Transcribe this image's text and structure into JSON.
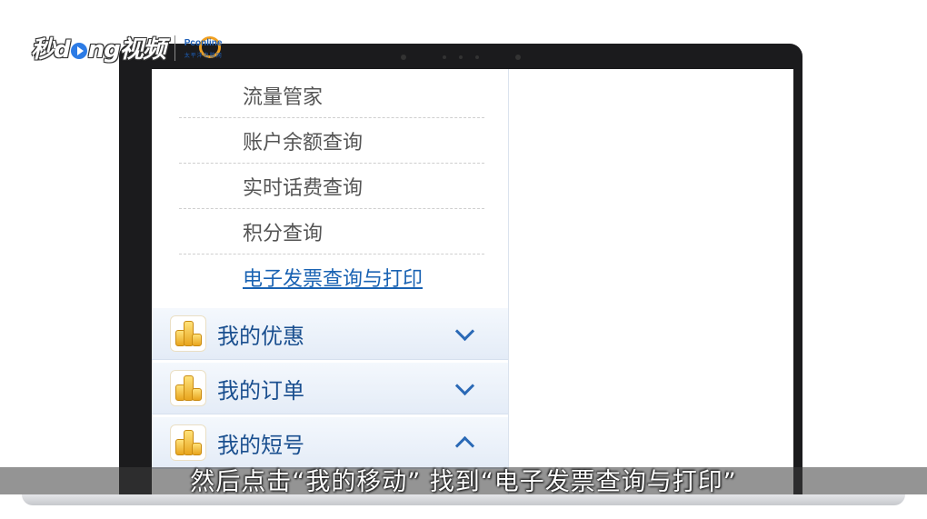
{
  "watermark": {
    "brand_pre": "秒d",
    "brand_post": "ng视频",
    "partner": "Pconline",
    "partner_cn": "太平洋电脑网"
  },
  "menu": {
    "sub_items": [
      {
        "label": "流量管家"
      },
      {
        "label": "账户余额查询"
      },
      {
        "label": "实时话费查询"
      },
      {
        "label": "积分查询"
      },
      {
        "label": "电子发票查询与打印"
      }
    ],
    "categories": [
      {
        "label": "我的优惠",
        "state": "collapsed"
      },
      {
        "label": "我的订单",
        "state": "collapsed"
      },
      {
        "label": "我的短号",
        "state": "expanded"
      }
    ]
  },
  "subtitle": "然后点击“我的移动” 找到“电子发票查询与打印”",
  "colors": {
    "link": "#1a63b3",
    "category_text": "#1a4f8f",
    "chevron": "#2a69b6"
  }
}
